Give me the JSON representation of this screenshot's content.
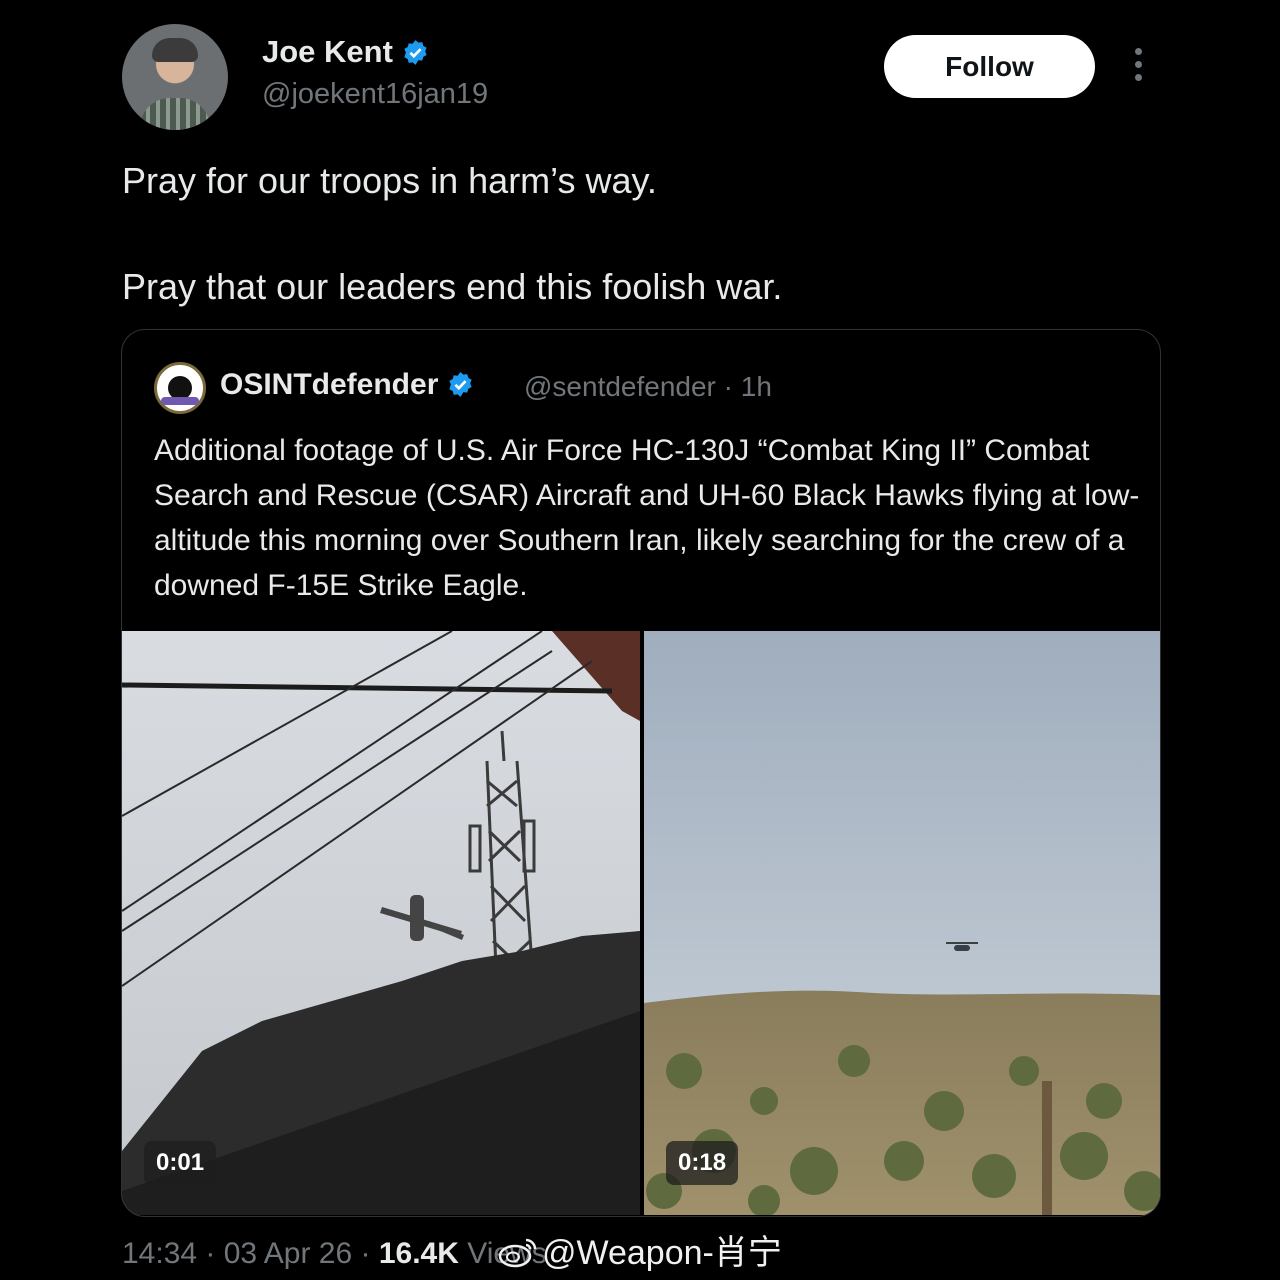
{
  "author": {
    "name": "Joe Kent",
    "handle": "@joekent16jan19",
    "follow_label": "Follow"
  },
  "tweet": {
    "line1": "Pray for our troops in harm’s way.",
    "line2": "Pray that our leaders end this foolish war."
  },
  "quote": {
    "name": "OSINTdefender",
    "handle": "@sentdefender",
    "time": "· 1h",
    "text": "Additional footage of U.S. Air Force HC-130J “Combat King II” Combat Search and Rescue (CSAR) Aircraft and UH-60 Black Hawks flying at low-altitude this morning over Southern Iran, likely searching for the crew of a downed F-15E Strike Eagle.",
    "videos": [
      {
        "duration": "0:01"
      },
      {
        "duration": "0:18"
      }
    ]
  },
  "footer": {
    "time": "14:34 · 03 Apr 26 · ",
    "views_count": "16.4K",
    "views_label": " Views"
  },
  "watermark": "@Weapon-肖宁",
  "colors": {
    "background": "#000000",
    "text": "#e7e9ea",
    "secondary": "#71767b",
    "verified": "#1d9bf0",
    "border": "#2f3336"
  }
}
